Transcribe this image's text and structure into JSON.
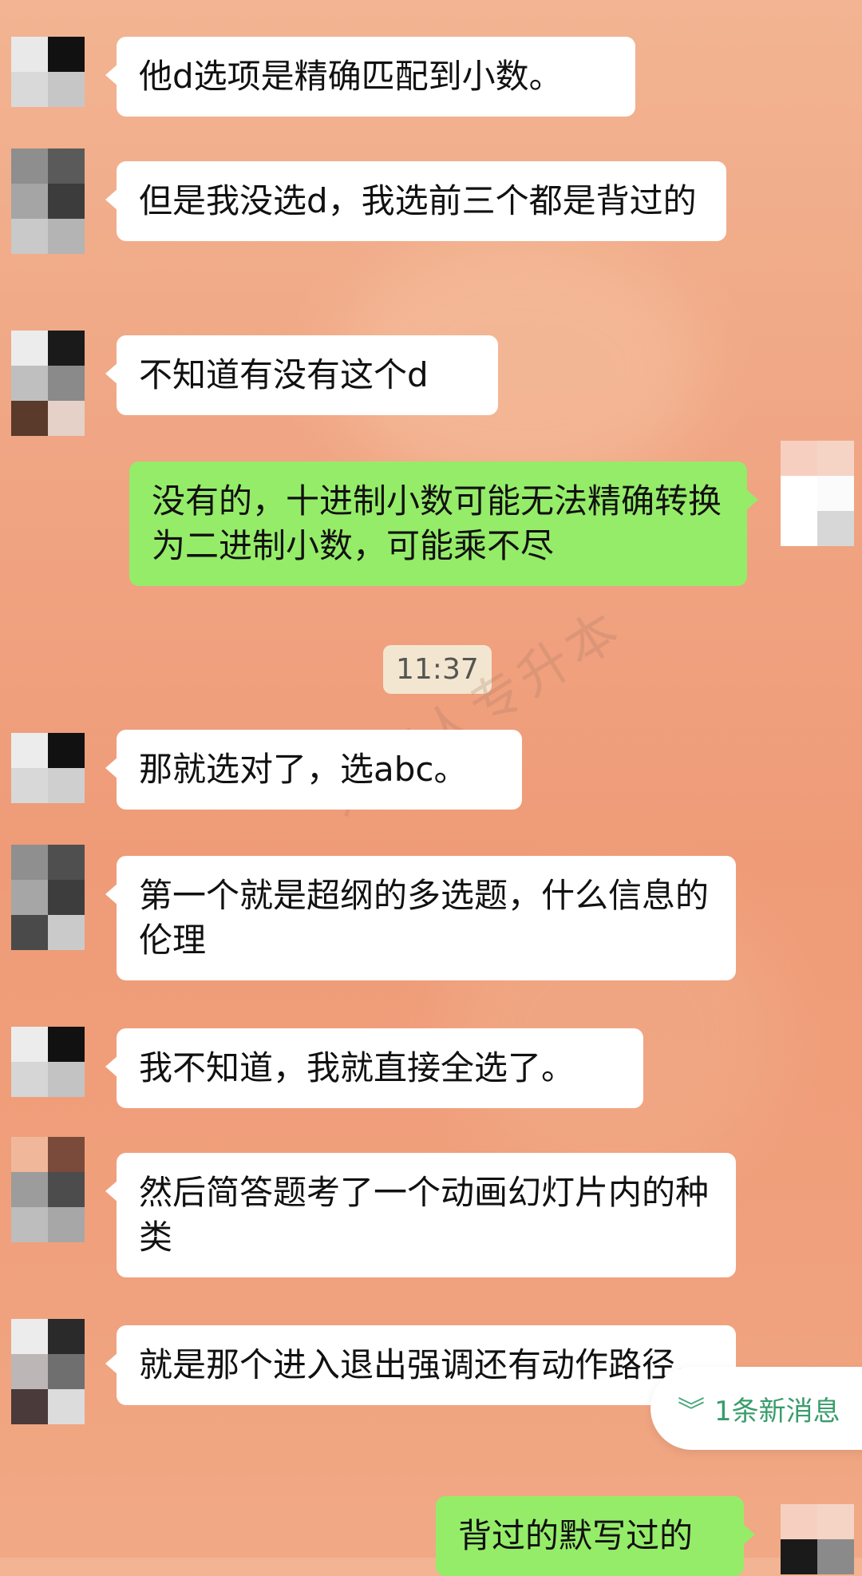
{
  "messages": [
    {
      "text": "他d选项是精确匹配到小数。"
    },
    {
      "text": "但是我没选d，我选前三个都是背过的"
    },
    {
      "text": "不知道有没有这个d"
    },
    {
      "text": "没有的，十进制小数可能无法精确转换为二进制小数，可能乘不尽"
    },
    {
      "text": "那就选对了，选abc。"
    },
    {
      "text": "第一个就是超纲的多选题，什么信息的伦理"
    },
    {
      "text": "我不知道，我就直接全选了。"
    },
    {
      "text": "然后简答题考了一个动画幻灯片内的种类"
    },
    {
      "text": "就是那个进入退出强调还有动作路径。"
    },
    {
      "text": "背过的默写过的"
    }
  ],
  "timestamp": "11:37",
  "watermark": "蓬蒿人专升本",
  "new_message_indicator": {
    "text": "1条新消息",
    "icon": "chevrons-down-icon"
  },
  "colors": {
    "incoming_bubble": "#ffffff",
    "outgoing_bubble": "#95ec69",
    "accent_green": "#3a9c6c"
  }
}
